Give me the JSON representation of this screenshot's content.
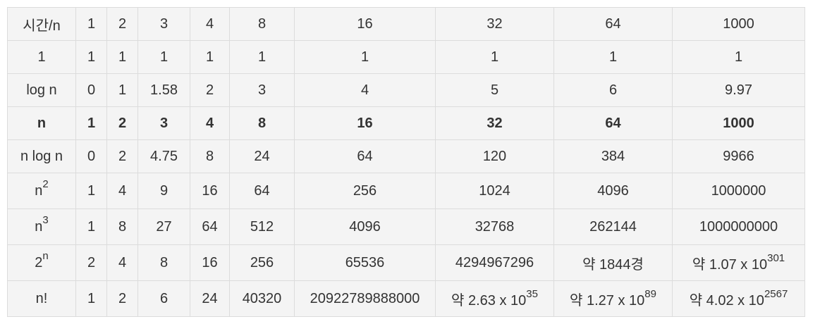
{
  "table": {
    "header": [
      "시간/n",
      "1",
      "2",
      "3",
      "4",
      "8",
      "16",
      "32",
      "64",
      "1000"
    ],
    "rows": [
      [
        "1",
        "1",
        "1",
        "1",
        "1",
        "1",
        "1",
        "1",
        "1",
        "1"
      ],
      [
        "log n",
        "0",
        "1",
        "1.58",
        "2",
        "3",
        "4",
        "5",
        "6",
        "9.97"
      ],
      [
        "n",
        "1",
        "2",
        "3",
        "4",
        "8",
        "16",
        "32",
        "64",
        "1000"
      ],
      [
        "n log n",
        "0",
        "2",
        "4.75",
        "8",
        "24",
        "64",
        "120",
        "384",
        "9966"
      ],
      [
        "n",
        "1",
        "4",
        "9",
        "16",
        "64",
        "256",
        "1024",
        "4096",
        "1000000"
      ],
      [
        "n",
        "1",
        "8",
        "27",
        "64",
        "512",
        "4096",
        "32768",
        "262144",
        "1000000000"
      ],
      [
        "2",
        "2",
        "4",
        "8",
        "16",
        "256",
        "65536",
        "4294967296",
        "약 1844경",
        "약 1.07 x 10"
      ],
      [
        "n!",
        "1",
        "2",
        "6",
        "24",
        "40320",
        "20922789888000",
        "약 2.63 x 10",
        "약 1.27 x 10",
        "약 4.02 x 10"
      ]
    ],
    "superscripts": {
      "n_squared": "2",
      "n_cubed": "3",
      "two_power": "n",
      "two_power_1000": "301",
      "fact_32": "35",
      "fact_64": "89",
      "fact_1000": "2567"
    }
  }
}
